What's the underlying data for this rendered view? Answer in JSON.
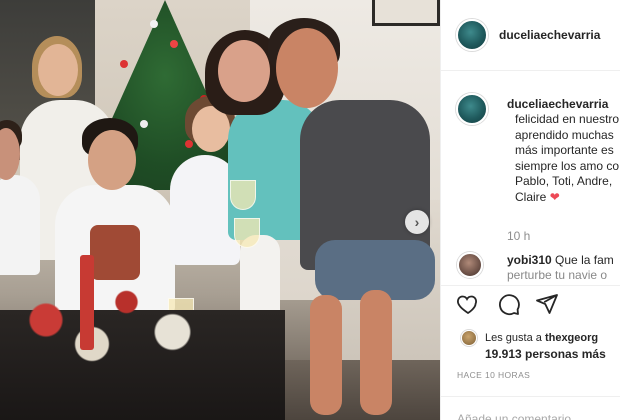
{
  "photo": {
    "alt_subject": "family-christmas-photo"
  },
  "post": {
    "author": "duceliaechevarria",
    "caption_lines": [
      "felicidad en nuestro",
      "aprendido muchas",
      "más importante es",
      "siempre los amo co",
      "Pablo, Toti, Andre,",
      "Claire"
    ],
    "time_ago": "10 h",
    "comment": {
      "user": "yobi310",
      "text": "Que la fam",
      "text_2": "perturbe tu navie o"
    },
    "likes_prefix": "Les gusta a",
    "likes_user": "thexgeorg",
    "likes_count": "19.913",
    "likes_suffix": "personas más",
    "posted_ago": "HACE 10 HORAS",
    "add_comment_placeholder": "Añade un comentario"
  },
  "colors": {
    "text": "#262626",
    "muted": "#8e8e8e",
    "heart": "#ed4956",
    "border": "#efefef"
  },
  "icons": {
    "like": "heart-icon",
    "comment": "comment-icon",
    "share": "share-icon",
    "next": "chevron-right-icon"
  }
}
